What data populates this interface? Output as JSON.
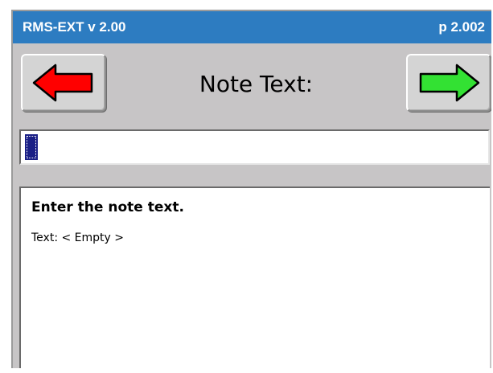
{
  "titlebar": {
    "app_title": "RMS-EXT v 2.00",
    "page_number": "p 2.002",
    "color": "#2d7cc1"
  },
  "navigation": {
    "back_icon": "red-left-arrow-icon",
    "next_icon": "green-right-arrow-icon",
    "back_color": "#ff0000",
    "next_color": "#33e133"
  },
  "screen": {
    "title": "Note Text:"
  },
  "input": {
    "value": ""
  },
  "info": {
    "heading": "Enter the note text.",
    "line": "Text: < Empty >"
  }
}
